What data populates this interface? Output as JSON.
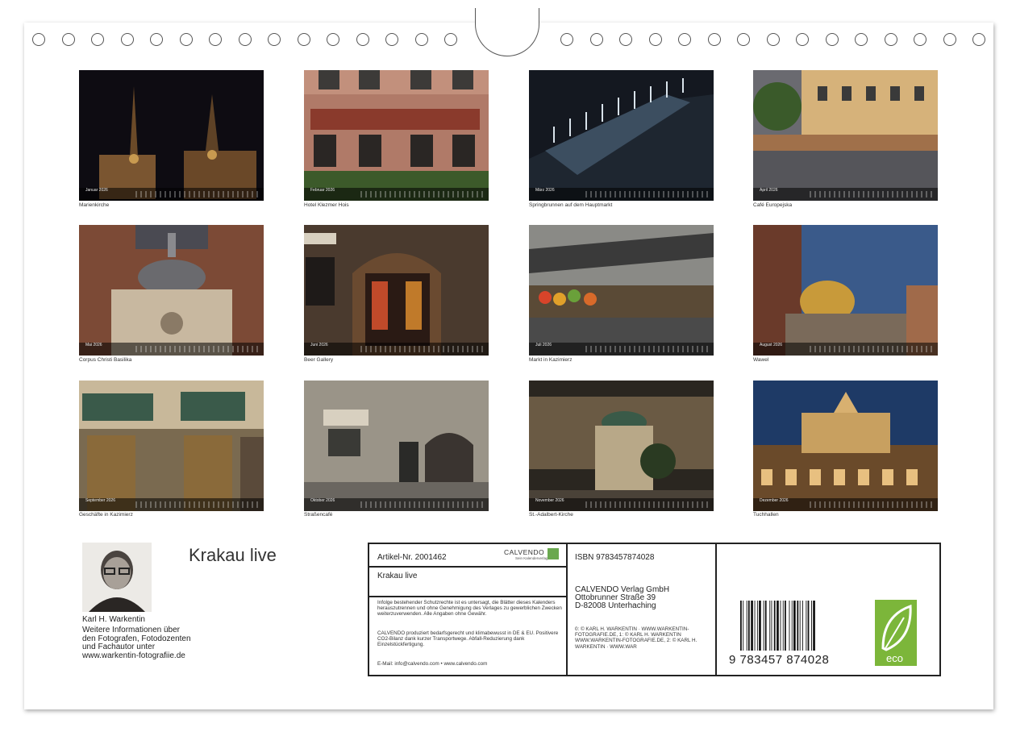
{
  "months": [
    {
      "label": "Januar 2026",
      "caption": "Marienkirche"
    },
    {
      "label": "Februar 2026",
      "caption": "Hotel Klezmer Hois"
    },
    {
      "label": "März 2026",
      "caption": "Springbrunnen auf dem Hauptmarkt"
    },
    {
      "label": "April 2026",
      "caption": "Café Europejska"
    },
    {
      "label": "Mai 2026",
      "caption": "Corpus Christi Basilika"
    },
    {
      "label": "Juni 2026",
      "caption": "Beer Gallery"
    },
    {
      "label": "Juli 2026",
      "caption": "Markt in Kazimierz"
    },
    {
      "label": "August 2026",
      "caption": "Wawel"
    },
    {
      "label": "September 2026",
      "caption": "Geschäfte in Kazimierz"
    },
    {
      "label": "Oktober 2026",
      "caption": "Straßencafé"
    },
    {
      "label": "November 2026",
      "caption": "St.-Adalbert-Kirche"
    },
    {
      "label": "Dezember 2026",
      "caption": "Tuchhallen"
    }
  ],
  "author": {
    "name": "Karl H. Warkentin",
    "info": "Weitere Informationen über den Fotografen, Fotodozenten und Fachautor unter www.warkentin-fotografiie.de"
  },
  "title": "Krakau live",
  "info_box": {
    "article_no": "Artikel-Nr. 2001462",
    "calvendo_logo": "CALVENDO",
    "calvendo_sub": "Sein Kalenderverlag",
    "product_title": "Krakau live",
    "legal": "Infolge bestehender Schutzrechte ist es untersagt, die Blätter dieses Kalenders herauszutrennen und ohne Genehmigung des Verlages zu gewerblichen Zwecken weiterzuverwenden. Alle Angaben ohne Gewähr.",
    "eco_note": "CALVENDO produziert bedarfsgerecht und klimabewusst in DE & EU. Positivere CO2-Bilanz dank kurzer Transportwege. Abfall-Reduzierung dank Einzelstückfertigung.",
    "contact": "E-Mail: info@calvendo.com • www.calvendo.com",
    "isbn": "ISBN 9783457874028",
    "publisher_line1": "CALVENDO Verlag GmbH",
    "publisher_line2": "Ottobrunner Straße 39",
    "publisher_line3": "D-82008 Unterhaching",
    "credits": "0: © KARL H. WARKENTIN · WWW.WARKENTIN-FOTOGRAFIE.DE, 1: © KARL H. WARKENTIN WWW.WARKENTIN-FOTOGRAFIE.DE, 2: © KARL H. WARKENTIN · WWW.WAR",
    "barcode_number": "9 783457 874028",
    "eco_label": "eco"
  }
}
